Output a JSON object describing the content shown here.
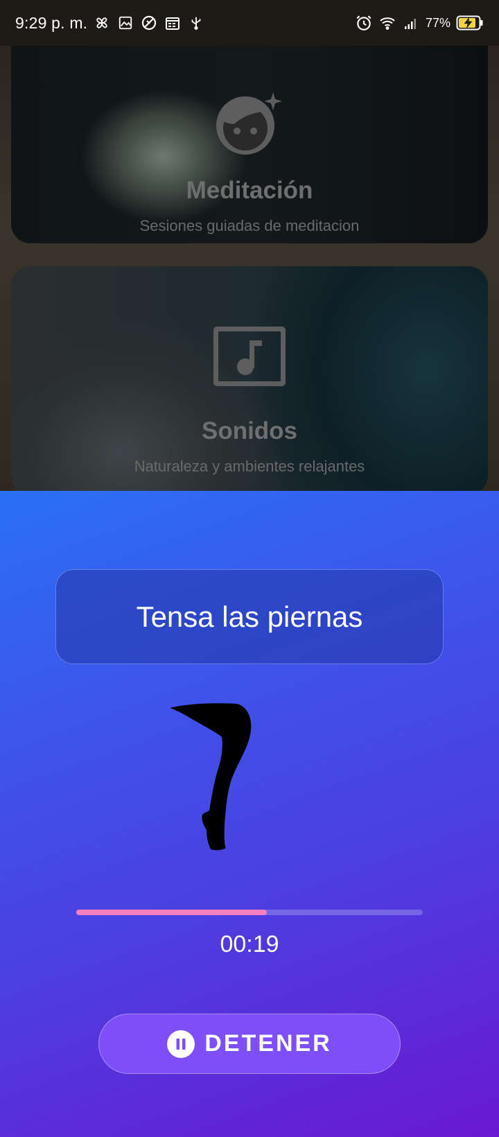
{
  "status_bar": {
    "time": "9:29 p. m.",
    "battery_percent": "77%",
    "left_icons": [
      "pinwheel-icon",
      "gallery-icon",
      "blocked-icon",
      "calendar-icon",
      "usb-icon"
    ],
    "right_icons": [
      "alarm-icon",
      "wifi-icon",
      "signal-icon",
      "battery-charging-icon"
    ]
  },
  "cards": [
    {
      "title": "Meditación",
      "subtitle": "Sesiones guiadas de meditacion",
      "icon": "face-sparkle-icon"
    },
    {
      "title": "Sonidos",
      "subtitle": "Naturaleza y ambientes relajantes",
      "icon": "music-note-icon"
    }
  ],
  "exercise": {
    "instruction": "Tensa las piernas",
    "illustration": "leg-icon",
    "progress": 0.55,
    "timer": "00:19",
    "stop_label": "DETENER",
    "stop_icon": "pause-circle-icon"
  },
  "colors": {
    "panel_gradient_start": "#2a70f5",
    "panel_gradient_end": "#6a19d0",
    "progress_fill": "#f57fc1",
    "button_bg": "#7e4ff8"
  }
}
